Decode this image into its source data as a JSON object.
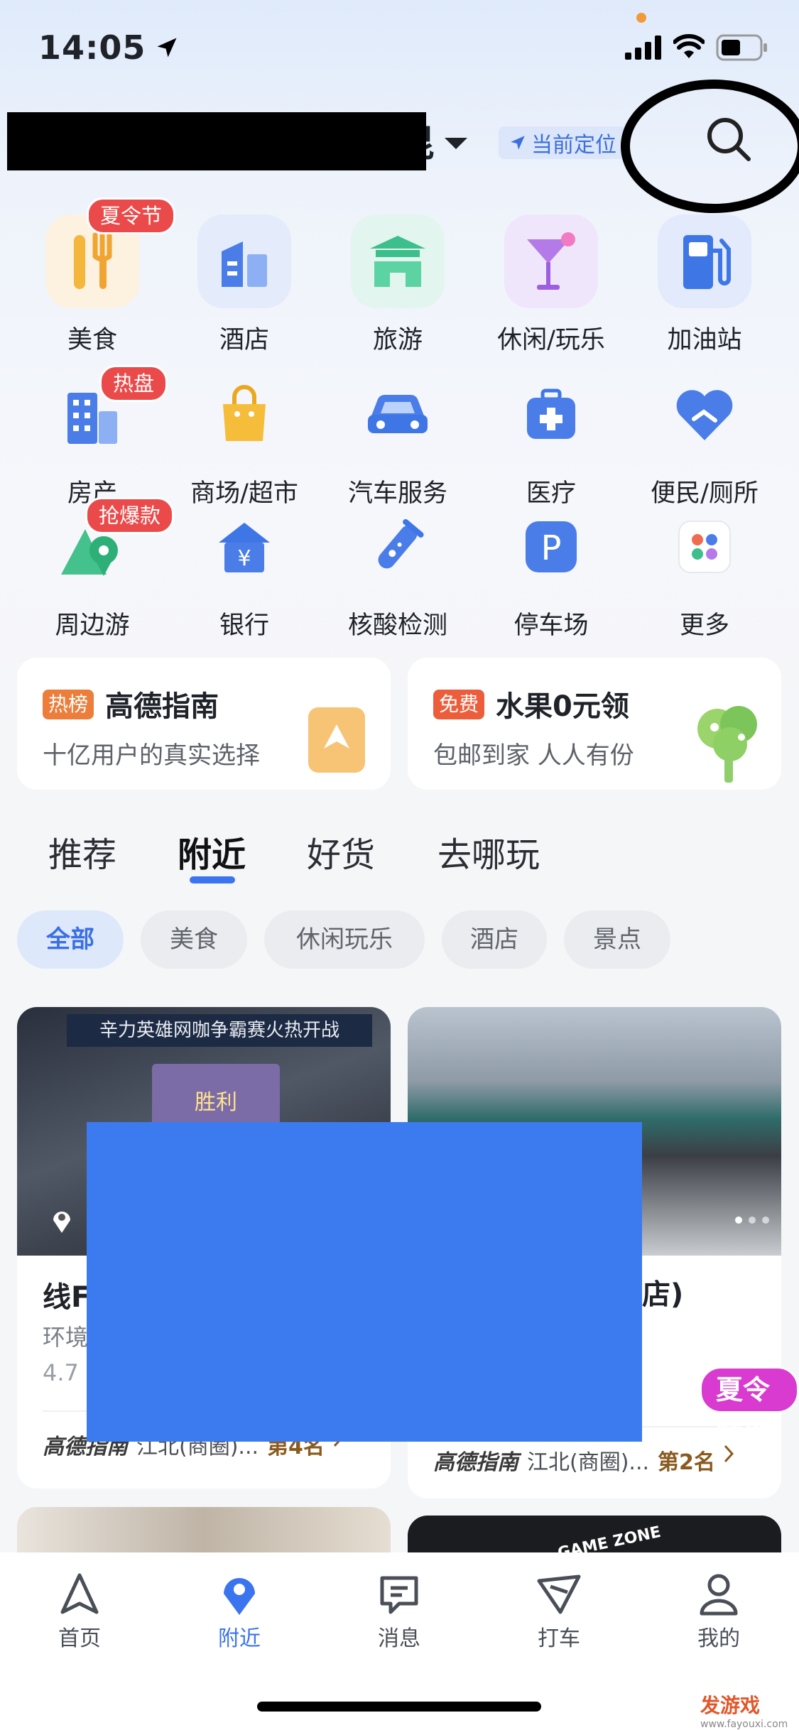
{
  "status_bar": {
    "time": "14:05"
  },
  "header": {
    "city_tail": "毘",
    "locate_label": "当前定位"
  },
  "categories": [
    {
      "label": "美食",
      "badge": "夏令节",
      "icon": "fork-knife-icon"
    },
    {
      "label": "酒店",
      "icon": "hotel-building-icon"
    },
    {
      "label": "旅游",
      "icon": "pavilion-icon"
    },
    {
      "label": "休闲/玩乐",
      "icon": "cocktail-icon"
    },
    {
      "label": "加油站",
      "icon": "gas-pump-icon"
    },
    {
      "label": "房产",
      "badge": "热盘",
      "icon": "apartment-icon"
    },
    {
      "label": "商场/超市",
      "icon": "shopping-bag-icon"
    },
    {
      "label": "汽车服务",
      "icon": "car-icon"
    },
    {
      "label": "医疗",
      "icon": "medical-kit-icon"
    },
    {
      "label": "便民/厕所",
      "icon": "heart-hand-icon"
    },
    {
      "label": "周边游",
      "badge": "抢爆款",
      "icon": "mountain-pin-icon"
    },
    {
      "label": "银行",
      "icon": "bank-yen-icon"
    },
    {
      "label": "核酸检测",
      "icon": "test-tube-icon"
    },
    {
      "label": "停车场",
      "icon": "parking-icon"
    },
    {
      "label": "更多",
      "icon": "more-dots-icon"
    }
  ],
  "promos": [
    {
      "tag": "热榜",
      "title": "高德指南",
      "subtitle": "十亿用户的真实选择"
    },
    {
      "tag": "免费",
      "title": "水果0元领",
      "subtitle": "包邮到家 人人有份"
    }
  ],
  "tabs": [
    "推荐",
    "附近",
    "好货",
    "去哪玩"
  ],
  "chips": [
    "全部",
    "美食",
    "休闲玩乐",
    "酒店",
    "景点"
  ],
  "feed": [
    {
      "title_visible": "线F",
      "meta": "环境",
      "rating": "4.7",
      "banner": "辛力英雄网咖争霸赛火热开战",
      "brand": "高德指南",
      "area": "江北(商圈)...",
      "rank": "第4名",
      "photo_text": "胜利"
    },
    {
      "title_visible": "店)",
      "brand": "高德指南",
      "area": "江北(商圈)...",
      "rank": "第2名",
      "promo_badge": "夏令特惠"
    },
    {
      "sign": "GAME ZONE"
    }
  ],
  "bottom_nav": [
    "首页",
    "附近",
    "消息",
    "打车",
    "我的"
  ],
  "watermark": {
    "line1": "发游戏",
    "line2": "www.fayouxi.com"
  }
}
